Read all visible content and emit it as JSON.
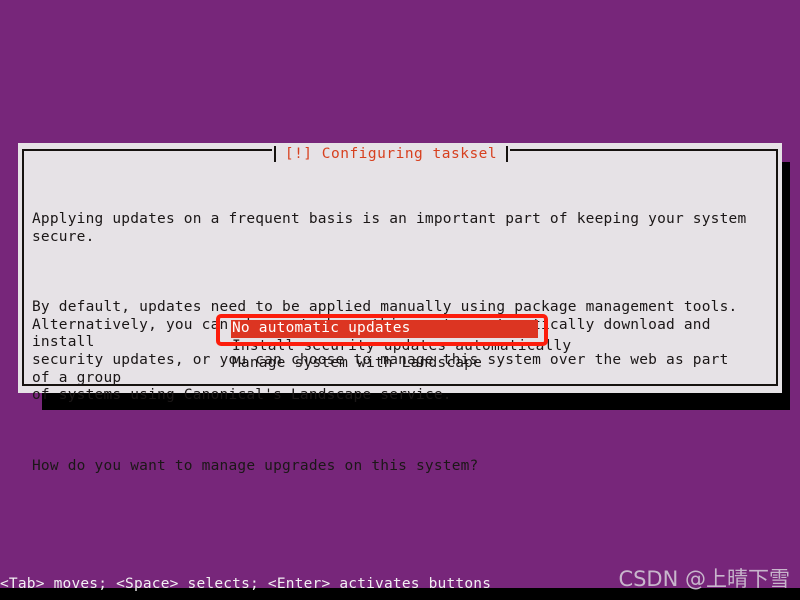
{
  "screen": {
    "background_color": "#77267a",
    "bottom_band_color": "#000000"
  },
  "dialog": {
    "title": "[!] Configuring tasksel",
    "title_color": "#d7401f",
    "background_color": "#e6e2e6",
    "border_color": "#16120f",
    "paragraphs": [
      "Applying updates on a frequent basis is an important part of keeping your system secure.",
      "By default, updates need to be applied manually using package management tools.\nAlternatively, you can choose to have this system automatically download and install\nsecurity updates, or you can choose to manage this system over the web as part of a group\nof systems using Canonical's Landscape service.",
      "How do you want to manage upgrades on this system?"
    ],
    "choices": [
      {
        "label": "No automatic updates",
        "selected": true
      },
      {
        "label": "Install security updates automatically",
        "selected": false
      },
      {
        "label": "Manage system with Landscape",
        "selected": false
      }
    ],
    "selection_highlight_color": "#dc3522",
    "selection_text_color": "#ffffff"
  },
  "annotation": {
    "shape": "rectangle",
    "color": "#fc1d0c",
    "target": "No automatic updates"
  },
  "status_bar": {
    "hint": "<Tab> moves; <Space> selects; <Enter> activates buttons",
    "text_color": "#f2eff2"
  },
  "watermark": {
    "text": "CSDN @上晴下雪",
    "color": "#cfc3d3"
  }
}
